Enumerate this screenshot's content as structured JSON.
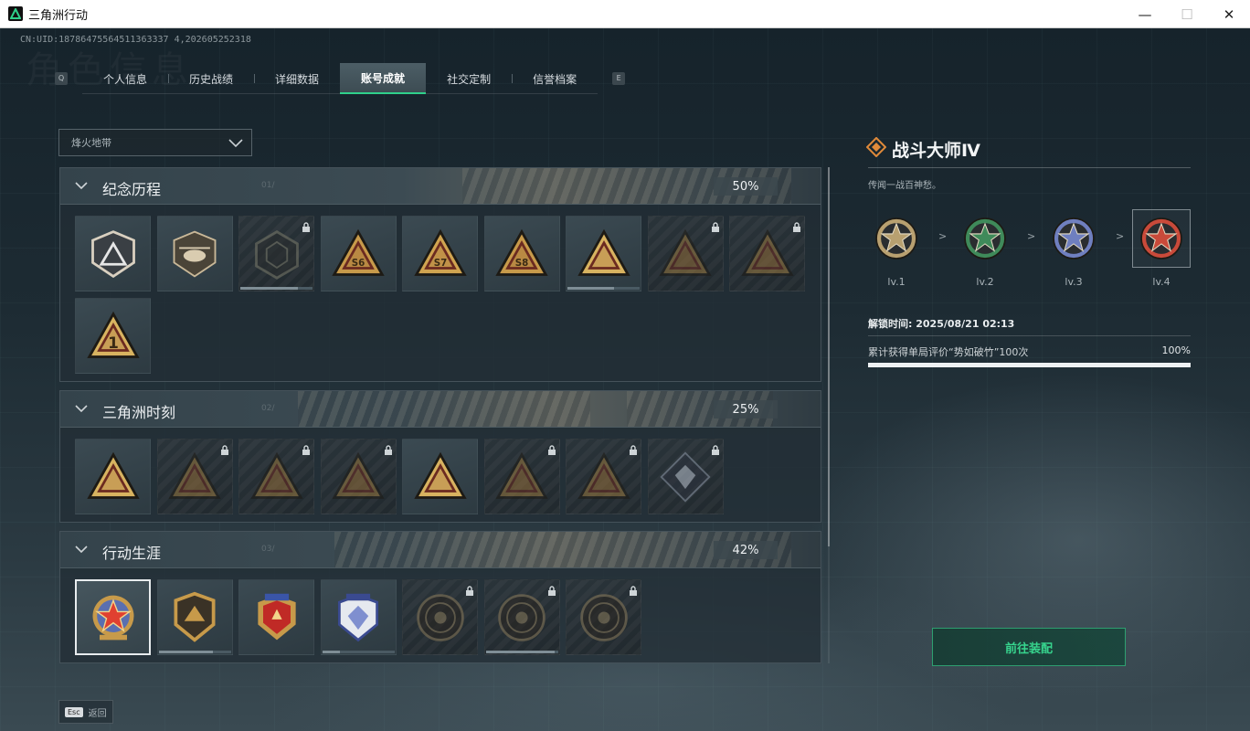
{
  "window": {
    "title": "三角洲行动",
    "controls": [
      "—",
      "☐",
      "✕"
    ]
  },
  "uid": "CN:UID:18786475564511363337 4,202605252318",
  "watermark": "角色信息",
  "tabs": {
    "left_key": "Q",
    "right_key": "E",
    "items": [
      {
        "label": "个人信息",
        "active": false
      },
      {
        "label": "历史战绩",
        "active": false
      },
      {
        "label": "详细数据",
        "active": false
      },
      {
        "label": "账号成就",
        "active": true
      },
      {
        "label": "社交定制",
        "active": false
      },
      {
        "label": "信誉档案",
        "active": false
      }
    ]
  },
  "mode_select": {
    "value": "烽火地带"
  },
  "sections": [
    {
      "title": "纪念历程",
      "subtitle": "01/",
      "percent": "50%",
      "badges": [
        {
          "icon": "triangle-shield-emblem",
          "locked": false,
          "shape": "shield",
          "color": "#9a9a9a"
        },
        {
          "icon": "helicopter-emblem",
          "locked": false,
          "shape": "helicopter",
          "color": "#b8a890"
        },
        {
          "icon": "dark-shield-emblem",
          "locked": true,
          "shape": "hex",
          "color": "#7a7a6a",
          "progress": 0.8
        },
        {
          "icon": "s6-triangle-emblem",
          "locked": false,
          "shape": "tri",
          "text": "S6",
          "color": "#c79a4a"
        },
        {
          "icon": "s7-triangle-emblem",
          "locked": false,
          "shape": "tri",
          "text": "S7",
          "color": "#d0a450"
        },
        {
          "icon": "s8-triangle-emblem",
          "locked": false,
          "shape": "tri",
          "text": "S8",
          "color": "#c79a4a"
        },
        {
          "icon": "tower-triangle-emblem",
          "locked": false,
          "shape": "tri",
          "color": "#d8b360",
          "progress": 0.65
        },
        {
          "icon": "woman-triangle-emblem",
          "locked": true,
          "shape": "tri",
          "color": "#9a7a40"
        },
        {
          "icon": "soldier-triangle-emblem",
          "locked": true,
          "shape": "tri",
          "color": "#9a7a40"
        },
        {
          "icon": "number-one-emblem",
          "locked": false,
          "shape": "tri",
          "text": "1",
          "color": "#d8b360"
        }
      ]
    },
    {
      "title": "三角洲时刻",
      "subtitle": "02/",
      "percent": "25%",
      "badges": [
        {
          "icon": "bottle-triangle-emblem",
          "locked": false,
          "shape": "tri",
          "color": "#d8b360"
        },
        {
          "icon": "robot-triangle-emblem",
          "locked": true,
          "shape": "tri",
          "color": "#9a7a40"
        },
        {
          "icon": "runner-triangle-emblem",
          "locked": true,
          "shape": "tri",
          "color": "#9a7a40"
        },
        {
          "icon": "soldiers-triangle-emblem",
          "locked": true,
          "shape": "tri",
          "color": "#9a7a40"
        },
        {
          "icon": "squad-triangle-emblem",
          "locked": false,
          "shape": "tri",
          "color": "#d8b360"
        },
        {
          "icon": "crowd-triangle-emblem",
          "locked": true,
          "shape": "tri",
          "color": "#9a7a40"
        },
        {
          "icon": "fist-triangle-emblem",
          "locked": true,
          "shape": "tri",
          "color": "#9a7a40"
        },
        {
          "icon": "diamond-card-emblem",
          "locked": true,
          "shape": "diamond",
          "color": "#8b96a6"
        }
      ]
    },
    {
      "title": "行动生涯",
      "subtitle": "03/",
      "percent": "42%",
      "badges": [
        {
          "icon": "combat-master-star-emblem",
          "locked": false,
          "shape": "star-medal",
          "color": "#c94a3a",
          "selected": true
        },
        {
          "icon": "gold-shield-emblem",
          "locked": false,
          "shape": "shield-gold",
          "color": "#c79a4a",
          "progress": 0.75
        },
        {
          "icon": "winged-shield-emblem",
          "locked": false,
          "shape": "shield-blue",
          "color": "#3a55a8"
        },
        {
          "icon": "diamond-shield-emblem",
          "locked": false,
          "shape": "shield-white",
          "color": "#3a4a90",
          "progress": 0.25
        },
        {
          "icon": "helmet-coin-emblem",
          "locked": true,
          "shape": "coin",
          "color": "#6a5a40"
        },
        {
          "icon": "skull-coin-emblem",
          "locked": true,
          "shape": "coin",
          "color": "#6a5a40",
          "progress": 0.95
        },
        {
          "icon": "eye-coin-emblem",
          "locked": true,
          "shape": "coin",
          "color": "#6a5a40"
        }
      ]
    }
  ],
  "detail": {
    "title": "战斗大师Ⅳ",
    "description": "传闻一战百神愁。",
    "levels": [
      {
        "label": "lv.1",
        "color": "#b8a070",
        "current": false
      },
      {
        "label": "lv.2",
        "color": "#3f8a5a",
        "current": false
      },
      {
        "label": "lv.3",
        "color": "#6f7fbf",
        "current": false
      },
      {
        "label": "lv.4",
        "color": "#c94a3a",
        "current": true
      }
    ],
    "separator": ">",
    "unlock_time": "解锁时间: 2025/08/21 02:13",
    "condition": "累计获得单局评价“势如破竹”100次",
    "condition_percent": "100%",
    "condition_progress": 1.0,
    "equip_label": "前往装配"
  },
  "footer": {
    "key": "Esc",
    "label": "返回"
  }
}
